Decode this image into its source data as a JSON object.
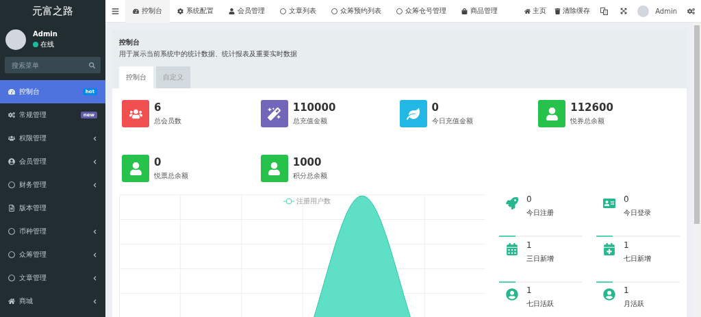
{
  "sidebar": {
    "logo": "元富之路",
    "user": {
      "name": "Admin",
      "status": "在线",
      "online": true
    },
    "search": {
      "placeholder": "搜索菜单"
    },
    "items": [
      {
        "label": "控制台",
        "selected": true,
        "expandable": false,
        "badge": {
          "text": "hot",
          "color": "#0089e8"
        }
      },
      {
        "label": "常规管理",
        "selected": false,
        "expandable": false,
        "badge": {
          "text": "new",
          "color": "#605ca8"
        }
      },
      {
        "label": "权限管理",
        "selected": false,
        "expandable": true
      },
      {
        "label": "会员管理",
        "selected": false,
        "expandable": true
      },
      {
        "label": "财务管理",
        "selected": false,
        "expandable": true
      },
      {
        "label": "版本管理",
        "selected": false,
        "expandable": false
      },
      {
        "label": "币种管理",
        "selected": false,
        "expandable": true
      },
      {
        "label": "众筹管理",
        "selected": false,
        "expandable": true
      },
      {
        "label": "文章管理",
        "selected": false,
        "expandable": true
      },
      {
        "label": "商城",
        "selected": false,
        "expandable": true
      }
    ]
  },
  "topbar": {
    "tabs": [
      {
        "label": "控制台",
        "selected": true
      },
      {
        "label": "系统配置",
        "selected": false
      },
      {
        "label": "会员管理",
        "selected": false
      },
      {
        "label": "文章列表",
        "selected": false
      },
      {
        "label": "众筹预约列表",
        "selected": false
      },
      {
        "label": "众筹仓号管理",
        "selected": false
      },
      {
        "label": "商品管理",
        "selected": false
      }
    ],
    "links": [
      "主页",
      "清除缓存"
    ],
    "user": "Admin"
  },
  "page": {
    "title": "控制台",
    "description": "用于展示当前系统中的统计数据、统计报表及重要实时数据",
    "tabs": [
      {
        "label": "控制台",
        "selected": true
      },
      {
        "label": "自定义",
        "selected": false
      }
    ],
    "stats": [
      {
        "value": "6",
        "label": "总会员数",
        "color": "#f05050"
      },
      {
        "value": "110000",
        "label": "总充值金额",
        "color": "#7266ba"
      },
      {
        "value": "0",
        "label": "今日充值金额",
        "color": "#23b7e5"
      },
      {
        "value": "112600",
        "label": "悦券总余额",
        "color": "#27c24c"
      },
      {
        "value": "0",
        "label": "悦票总余额",
        "color": "#27c24c"
      },
      {
        "value": "1000",
        "label": "积分总余额",
        "color": "#27c24c"
      }
    ],
    "chart": {
      "legend": "注册用户数"
    },
    "mini_stats": [
      {
        "value": "0",
        "label": "今日注册"
      },
      {
        "value": "0",
        "label": "今日登录"
      },
      {
        "value": "1",
        "label": "三日新增"
      },
      {
        "value": "1",
        "label": "七日新增"
      },
      {
        "value": "1",
        "label": "七日活跃"
      },
      {
        "value": "1",
        "label": "月活跃"
      }
    ]
  }
}
